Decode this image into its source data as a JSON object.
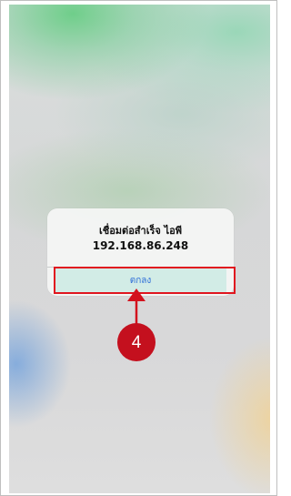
{
  "dialog": {
    "title": "เชื่อมต่อสำเร็จ ไอพี",
    "message": "192.168.86.248",
    "ok_label": "ตกลง"
  },
  "annotation": {
    "step_number": "4",
    "highlight_color": "#e0161f",
    "badge_color": "#c4101e"
  },
  "colors": {
    "button_text": "#2f6fd8",
    "button_highlight": "#d2ece6"
  }
}
